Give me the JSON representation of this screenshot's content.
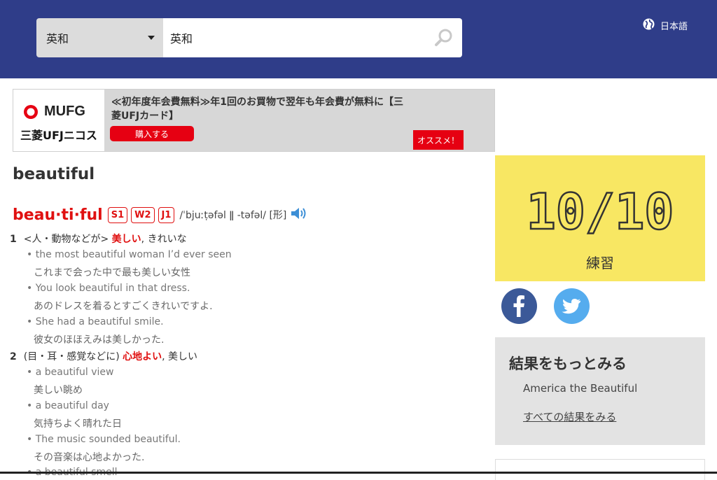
{
  "header": {
    "dict_select": "英和",
    "search_value": "英和",
    "language": "日本語"
  },
  "ad": {
    "brand": "MUFG",
    "sub_brand": "三菱UFJニコス",
    "text": "≪初年度年会費無料≫年1回のお買物で翌年も年会費が無料に【三菱UFJカード】",
    "buy_label": "購入する",
    "recommend_label": "オススメ！"
  },
  "entry": {
    "word": "beautiful",
    "headword": "beau·ti·ful",
    "badges": [
      "S1",
      "W2",
      "J1"
    ],
    "pronunciation": "/ˈbjuːṭəfəl ǁ -təfəl/ [形]",
    "senses": [
      {
        "num": "1",
        "pre": "<人・動物などが> ",
        "highlight": "美しい",
        "post": ", きれいな",
        "examples": [
          {
            "en": "• the most beautiful woman I’d ever seen",
            "ja": "これまで会った中で最も美しい女性"
          },
          {
            "en": "• You look beautiful in that dress.",
            "ja": "あのドレスを着るとすごくきれいですよ."
          },
          {
            "en": "• She had a beautiful smile.",
            "ja": "彼女のほほえみは美しかった."
          }
        ]
      },
      {
        "num": "2",
        "pre": "(目・耳・感覚などに) ",
        "highlight": "心地よい",
        "post": ", 美しい",
        "examples": [
          {
            "en": "• a beautiful view",
            "ja": "美しい眺め"
          },
          {
            "en": "• a beautiful day",
            "ja": "気持ちよく晴れた日"
          },
          {
            "en": "• The music sounded beautiful.",
            "ja": "その音楽は心地よかった."
          },
          {
            "en": "• a beautiful smell",
            "ja": ""
          }
        ]
      }
    ]
  },
  "sidebar": {
    "score": "10/10",
    "score_label": "練習",
    "more_title": "結果をもっとみる",
    "more_item": "America the Beautiful",
    "more_link": "すべての結果をみる"
  },
  "colors": {
    "header_bg": "#2f3d89",
    "accent_red": "#e01010",
    "score_bg": "#f8e763",
    "facebook": "#3b5998",
    "twitter": "#55acee"
  },
  "icons": [
    "search-icon",
    "globe-icon",
    "speaker-icon",
    "facebook-icon",
    "twitter-icon",
    "dropdown-caret-icon"
  ]
}
